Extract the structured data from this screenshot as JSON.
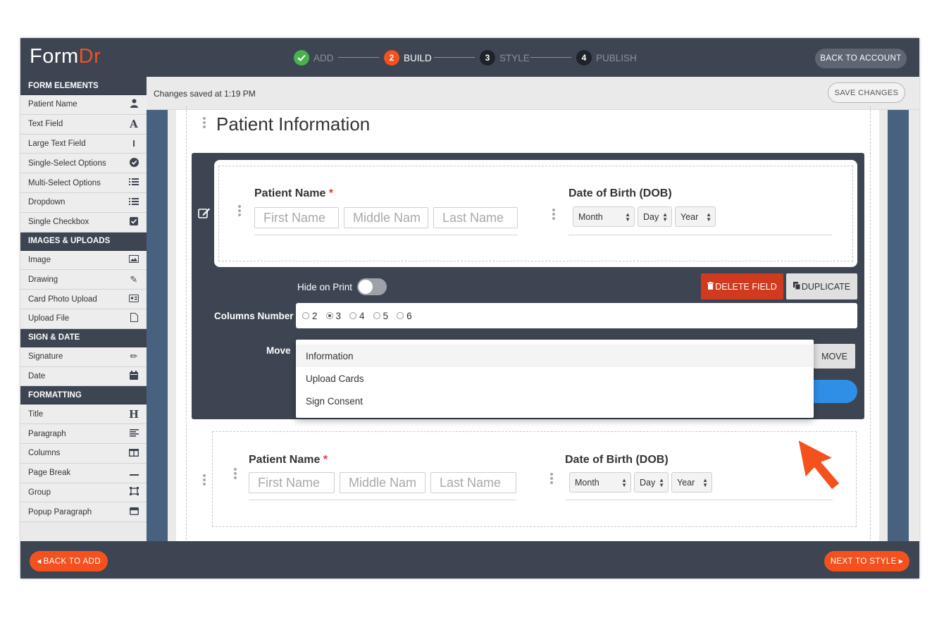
{
  "app": {
    "logo_main": "Form",
    "logo_accent": "Dr",
    "brand_color": "#f4511e",
    "header_bg": "#3d4552"
  },
  "steps": [
    {
      "num": "✓",
      "label": "ADD",
      "state": "done"
    },
    {
      "num": "2",
      "label": "BUILD",
      "state": "active"
    },
    {
      "num": "3",
      "label": "STYLE",
      "state": "pending"
    },
    {
      "num": "4",
      "label": "PUBLISH",
      "state": "pending"
    }
  ],
  "header": {
    "back_to_account": "BACK TO ACCOUNT"
  },
  "savebar": {
    "message": "Changes saved at 1:19 PM",
    "save_button": "SAVE CHANGES"
  },
  "sidebar": {
    "sections": [
      {
        "title": "FORM ELEMENTS",
        "items": [
          {
            "label": "Patient Name",
            "icon": "person-icon"
          },
          {
            "label": "Text Field",
            "icon": "letter-a-icon"
          },
          {
            "label": "Large Text Field",
            "icon": "text-cursor-icon"
          },
          {
            "label": "Single-Select Options",
            "icon": "check-circle-icon"
          },
          {
            "label": "Multi-Select Options",
            "icon": "list-icon"
          },
          {
            "label": "Dropdown",
            "icon": "list-icon"
          },
          {
            "label": "Single Checkbox",
            "icon": "checkbox-icon"
          }
        ]
      },
      {
        "title": "IMAGES & UPLOADS",
        "items": [
          {
            "label": "Image",
            "icon": "image-icon"
          },
          {
            "label": "Drawing",
            "icon": "edit-icon"
          },
          {
            "label": "Card Photo Upload",
            "icon": "id-card-icon"
          },
          {
            "label": "Upload File",
            "icon": "file-icon"
          }
        ]
      },
      {
        "title": "SIGN & DATE",
        "items": [
          {
            "label": "Signature",
            "icon": "pencil-icon"
          },
          {
            "label": "Date",
            "icon": "calendar-icon"
          }
        ]
      },
      {
        "title": "FORMATTING",
        "items": [
          {
            "label": "Title",
            "icon": "heading-icon"
          },
          {
            "label": "Paragraph",
            "icon": "align-left-icon"
          },
          {
            "label": "Columns",
            "icon": "columns-icon"
          },
          {
            "label": "Page Break",
            "icon": "minus-icon"
          },
          {
            "label": "Group",
            "icon": "group-icon"
          },
          {
            "label": "Popup Paragraph",
            "icon": "window-icon"
          }
        ]
      }
    ]
  },
  "form": {
    "section_title": "Patient Information",
    "field": {
      "name_label": "Patient Name",
      "required_mark": "*",
      "first_placeholder": "First Name",
      "middle_placeholder": "Middle Nam",
      "last_placeholder": "Last Name",
      "dob_label": "Date of Birth (DOB)",
      "month": "Month",
      "day": "Day",
      "year": "Year"
    },
    "editor": {
      "hide_on_print": "Hide on Print",
      "delete_button": "DELETE FIELD",
      "duplicate_button": "DUPLICATE",
      "columns_label": "Columns Number",
      "column_options": [
        "2",
        "3",
        "4",
        "5",
        "6"
      ],
      "columns_selected": "3",
      "move_label": "Move",
      "move_button": "MOVE",
      "move_options": [
        "Information",
        "Upload Cards",
        "Sign Consent"
      ]
    }
  },
  "footer": {
    "back_button": "BACK TO ADD",
    "next_button": "NEXT TO STYLE"
  }
}
